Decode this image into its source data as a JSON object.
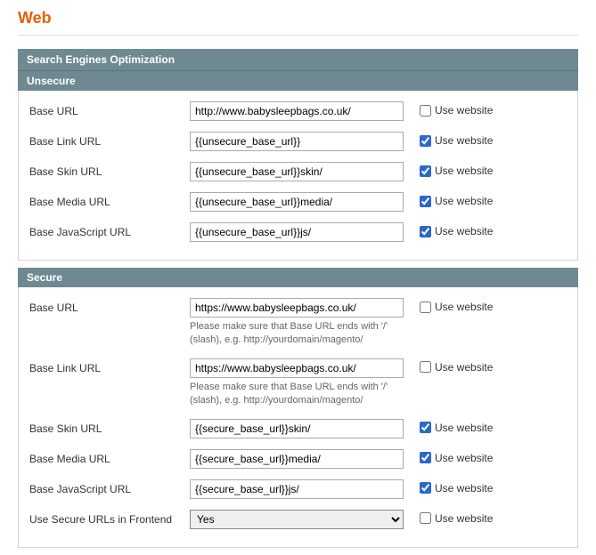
{
  "page_title": "Web",
  "sections": {
    "seo_header": "Search Engines Optimization",
    "unsecure_header": "Unsecure",
    "secure_header": "Secure"
  },
  "labels": {
    "base_url": "Base URL",
    "base_link_url": "Base Link URL",
    "base_skin_url": "Base Skin URL",
    "base_media_url": "Base Media URL",
    "base_js_url": "Base JavaScript URL",
    "use_secure_frontend": "Use Secure URLs in Frontend",
    "use_website": "Use website"
  },
  "hints": {
    "base_url_slash": "Please make sure that Base URL ends with '/' (slash), e.g. http://yourdomain/magento/"
  },
  "unsecure": {
    "base_url": {
      "value": "http://www.babysleepbags.co.uk/",
      "use_website": false
    },
    "base_link_url": {
      "value": "{{unsecure_base_url}}",
      "use_website": true
    },
    "base_skin_url": {
      "value": "{{unsecure_base_url}}skin/",
      "use_website": true
    },
    "base_media_url": {
      "value": "{{unsecure_base_url}}media/",
      "use_website": true
    },
    "base_js_url": {
      "value": "{{unsecure_base_url}}js/",
      "use_website": true
    }
  },
  "secure": {
    "base_url": {
      "value": "https://www.babysleepbags.co.uk/",
      "use_website": false
    },
    "base_link_url": {
      "value": "https://www.babysleepbags.co.uk/",
      "use_website": false
    },
    "base_skin_url": {
      "value": "{{secure_base_url}}skin/",
      "use_website": true
    },
    "base_media_url": {
      "value": "{{secure_base_url}}media/",
      "use_website": true
    },
    "base_js_url": {
      "value": "{{secure_base_url}}js/",
      "use_website": true
    },
    "use_secure_frontend": {
      "value": "Yes",
      "use_website": false
    }
  },
  "select_options": {
    "yes": "Yes"
  }
}
